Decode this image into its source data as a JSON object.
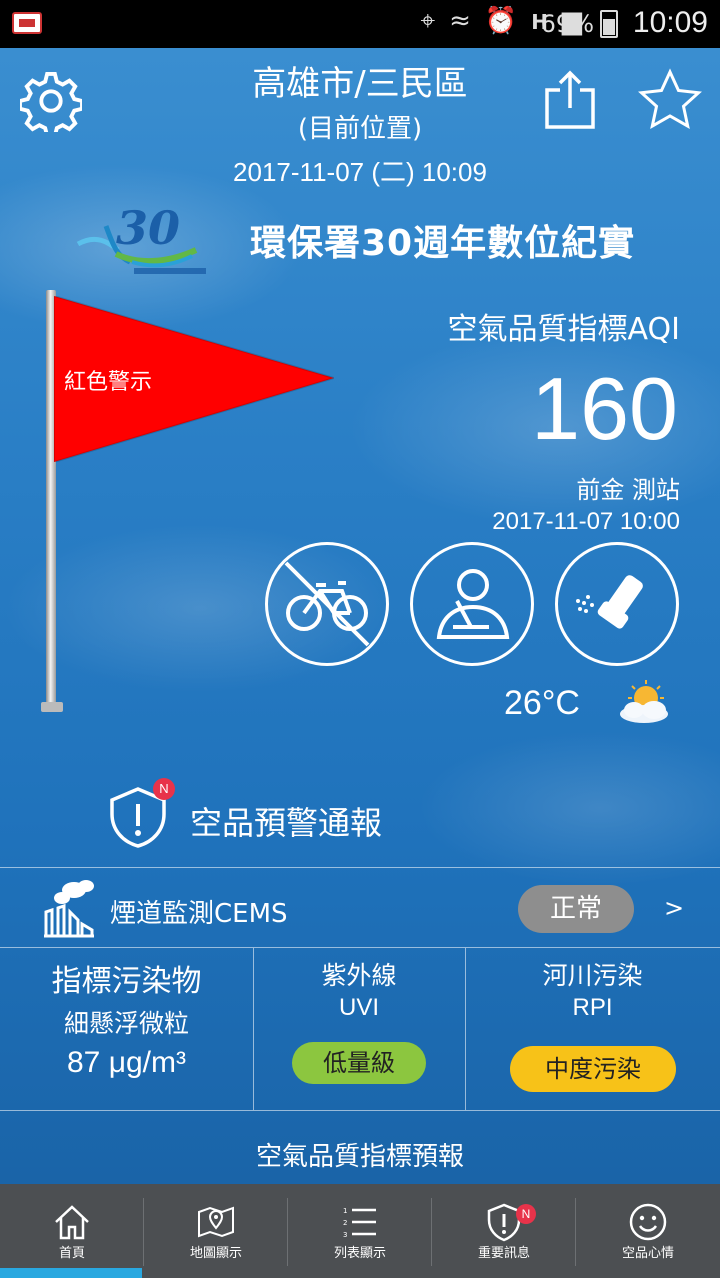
{
  "status_bar": {
    "battery_percent": "69%",
    "time": "10:09",
    "icons": [
      "location-icon",
      "vibrate-off-icon",
      "alarm-icon",
      "hspa-icon",
      "signal-icon",
      "battery-icon"
    ]
  },
  "header": {
    "location": "高雄市/三民區",
    "location_note": "(目前位置)",
    "datetime": "2017-11-07 (二) 10:09"
  },
  "banner": {
    "title": "環保署30週年數位紀實"
  },
  "flag": {
    "label": "紅色警示",
    "color": "#ff0000"
  },
  "aqi": {
    "title": "空氣品質指標AQI",
    "value": "160",
    "station": "前金 測站",
    "time": "2017-11-07 10:00"
  },
  "advice_icons": [
    "no-cycling-icon",
    "stay-indoors-icon",
    "inhaler-icon"
  ],
  "weather": {
    "temperature": "26°C",
    "icon": "partly-cloudy-icon"
  },
  "alert": {
    "label": "空品預警通報",
    "badge": "N"
  },
  "cems": {
    "label": "煙道監測CEMS",
    "status": "正常",
    "arrow": ">"
  },
  "metrics": {
    "pollutant": {
      "title": "指標污染物",
      "name": "細懸浮微粒",
      "value": "87  μg/m³"
    },
    "uvi": {
      "title": "紫外線",
      "sub": "UVI",
      "level": "低量級",
      "color": "#8cc63f"
    },
    "rpi": {
      "title": "河川污染",
      "sub": "RPI",
      "level": "中度污染",
      "color": "#f7c218"
    }
  },
  "forecast": {
    "label": "空氣品質指標預報"
  },
  "tabs": [
    {
      "label": "首頁",
      "icon": "home-icon",
      "active": true
    },
    {
      "label": "地圖顯示",
      "icon": "map-icon",
      "active": false
    },
    {
      "label": "列表顯示",
      "icon": "list-icon",
      "active": false
    },
    {
      "label": "重要訊息",
      "icon": "alert-shield-icon",
      "active": false,
      "badge": "N"
    },
    {
      "label": "空品心情",
      "icon": "smiley-icon",
      "active": false
    }
  ],
  "colors": {
    "background": "#2a7fc6",
    "tab_bar": "#4c4f52",
    "active_tab": "#29a8e0",
    "badge": "#e8334a",
    "cems_status": "#8e8e8e"
  }
}
